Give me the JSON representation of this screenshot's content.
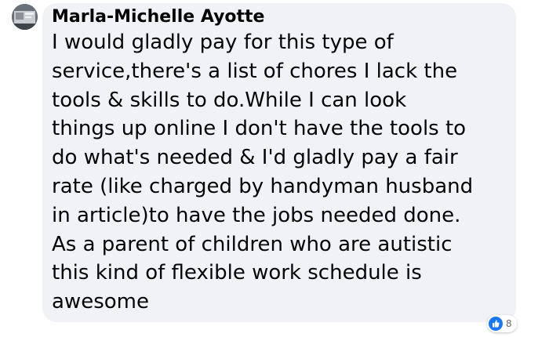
{
  "comment": {
    "author": "Marla-Michelle Ayotte",
    "text": "I would gladly pay for this type of\nservice,there's a list of chores I lack the\ntools & skills to do.While I can look\nthings up online I don't have the tools to\ndo what's needed & I'd gladly pay a fair\nrate (like charged by handyman husband\nin article)to have the jobs needed done.\nAs a parent of children who are autistic\nthis kind of flexible work schedule is\nawesome",
    "avatar_icon": "profile-photo",
    "bubble_color": "#f0f2f5"
  },
  "reactions": {
    "icon": "like-thumbs-up-icon",
    "icon_color": "#1877f2",
    "count": "8"
  }
}
